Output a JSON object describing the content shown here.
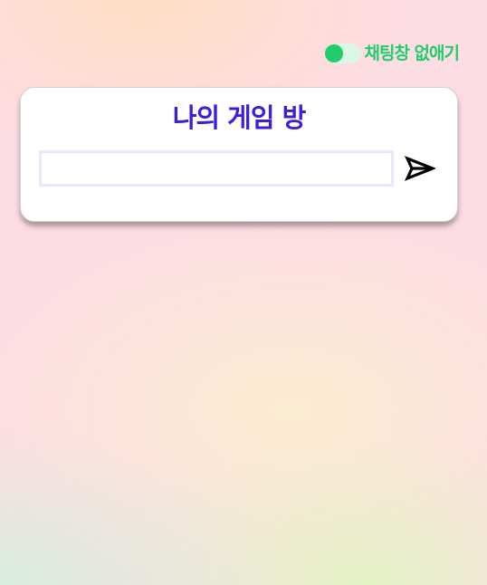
{
  "chat_toggle": {
    "label": "채팅창 없애기",
    "state": "on",
    "color": "#22cc6a"
  },
  "room_card": {
    "title": "나의 게임 방",
    "title_color": "#3c1fd6",
    "input": {
      "value": "",
      "placeholder": ""
    },
    "send_icon": "send-icon"
  }
}
